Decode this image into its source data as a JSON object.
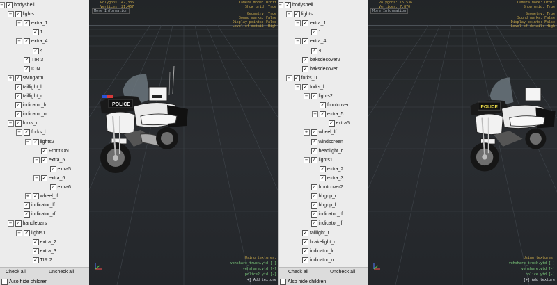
{
  "left": {
    "overlay": {
      "tl": [
        "Polygons: 42,336",
        "Vertices: 21,467"
      ],
      "more_info": "More Information",
      "tr": [
        "Camera mode: Orbit",
        "Show grid: True"
      ],
      "tr2": [
        "Geometry: True",
        "Sound marks: False",
        "Display points: False",
        "Level of detail: High"
      ],
      "textures_title": "Using textures:",
      "textures": [
        "vehshare_truck.ytd [-]",
        "vehshare.ytd [-]",
        "police2.ytd [-]"
      ],
      "add_texture": "[+] Add texture"
    },
    "tree": [
      {
        "label": "bodyshell",
        "exp": "minus"
      },
      {
        "label": "lights",
        "exp": "minus"
      },
      {
        "label": "extra_1",
        "exp": "minus"
      },
      {
        "label": "1",
        "exp": ""
      },
      {
        "label": "extra_4",
        "exp": "minus"
      },
      {
        "label": "4",
        "exp": ""
      },
      {
        "label": "TIR 3",
        "exp": ""
      },
      {
        "label": "ION",
        "exp": ""
      },
      {
        "label": "swingarm",
        "exp": "plus"
      },
      {
        "label": "taillight_l",
        "exp": ""
      },
      {
        "label": "taillight_r",
        "exp": ""
      },
      {
        "label": "indicator_lr",
        "exp": ""
      },
      {
        "label": "indicator_rr",
        "exp": ""
      },
      {
        "label": "forks_u",
        "exp": "minus"
      },
      {
        "label": "forks_l",
        "exp": "minus"
      },
      {
        "label": "lights2",
        "exp": "minus"
      },
      {
        "label": "FrontION",
        "exp": ""
      },
      {
        "label": "extra_5",
        "exp": "minus"
      },
      {
        "label": "extra5",
        "exp": ""
      },
      {
        "label": "extra_6",
        "exp": "minus"
      },
      {
        "label": "extra6",
        "exp": ""
      },
      {
        "label": "wheel_lf",
        "exp": "plus"
      },
      {
        "label": "indicator_lf",
        "exp": ""
      },
      {
        "label": "indicator_rf",
        "exp": ""
      },
      {
        "label": "handlebars",
        "exp": "minus"
      },
      {
        "label": "lights1",
        "exp": "minus"
      },
      {
        "label": "extra_2",
        "exp": ""
      },
      {
        "label": "extra_3",
        "exp": ""
      },
      {
        "label": "TIR 2",
        "exp": ""
      }
    ]
  },
  "right": {
    "overlay": {
      "tl": [
        "Polygons: 15,536",
        "Vertices: 7,870"
      ],
      "more_info": "More Information",
      "tr": [
        "Camera mode: Orbit",
        "Show grid: True"
      ],
      "tr2": [
        "Geometry: True",
        "Sound marks: False",
        "Display points: False",
        "Level of detail: High"
      ],
      "textures_title": "Using textures:",
      "textures": [
        "vehshare_truck.ytd [-]",
        "vehshare.ytd [-]",
        "police.ytd [-]"
      ],
      "add_texture": "[+] Add texture"
    },
    "tree": [
      {
        "label": "bodyshell",
        "exp": "minus"
      },
      {
        "label": "lights",
        "exp": "minus"
      },
      {
        "label": "extra_1",
        "exp": "minus"
      },
      {
        "label": "1",
        "exp": ""
      },
      {
        "label": "extra_4",
        "exp": "minus"
      },
      {
        "label": "4",
        "exp": ""
      },
      {
        "label": "baksdecover2",
        "exp": ""
      },
      {
        "label": "baksdecover",
        "exp": ""
      },
      {
        "label": "forks_u",
        "exp": "minus"
      },
      {
        "label": "forks_l",
        "exp": "minus"
      },
      {
        "label": "lights2",
        "exp": "minus"
      },
      {
        "label": "frontcover",
        "exp": ""
      },
      {
        "label": "extra_5",
        "exp": "minus"
      },
      {
        "label": "extra5",
        "exp": ""
      },
      {
        "label": "wheel_lf",
        "exp": "plus"
      },
      {
        "label": "windscreen",
        "exp": ""
      },
      {
        "label": "headlight_r",
        "exp": ""
      },
      {
        "label": "lights1",
        "exp": "minus"
      },
      {
        "label": "extra_2",
        "exp": ""
      },
      {
        "label": "extra_3",
        "exp": ""
      },
      {
        "label": "frontcover2",
        "exp": ""
      },
      {
        "label": "hbgrip_r",
        "exp": ""
      },
      {
        "label": "hbgrip_l",
        "exp": ""
      },
      {
        "label": "indicator_rf",
        "exp": ""
      },
      {
        "label": "indicator_lf",
        "exp": ""
      },
      {
        "label": "taillight_r",
        "exp": ""
      },
      {
        "label": "brakelight_r",
        "exp": ""
      },
      {
        "label": "indicator_lr",
        "exp": ""
      },
      {
        "label": "indicator_rr",
        "exp": ""
      }
    ]
  },
  "buttons": {
    "check_all": "Check all",
    "uncheck_all": "Uncheck all",
    "also_hide": "Also hide children"
  },
  "police_text": "POLICE",
  "colors": {
    "overlay_gold": "#c9a94a",
    "texture_green": "#7fd07f"
  }
}
